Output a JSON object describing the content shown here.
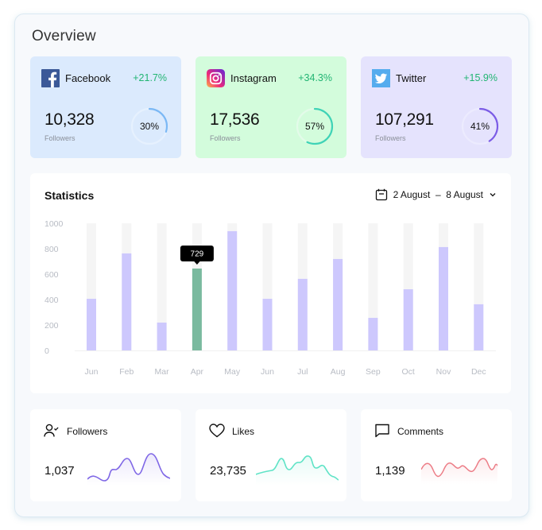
{
  "page": {
    "title": "Overview"
  },
  "social_cards": [
    {
      "network": "Facebook",
      "icon": "facebook-logo-icon",
      "change": "+21.7%",
      "followers": "10,328",
      "followers_label": "Followers",
      "percent_label": "30%",
      "percent": 30,
      "bg": "#dbeafd",
      "ring_color": "#7bb8f5",
      "track_color": "#e6f1fe"
    },
    {
      "network": "Instagram",
      "icon": "instagram-logo-icon",
      "change": "+34.3%",
      "followers": "17,536",
      "followers_label": "Followers",
      "percent_label": "57%",
      "percent": 57,
      "bg": "#d3fcdc",
      "ring_color": "#3fd3b6",
      "track_color": "#e3fbe9"
    },
    {
      "network": "Twitter",
      "icon": "twitter-logo-icon",
      "change": "+15.9%",
      "followers": "107,291",
      "followers_label": "Followers",
      "percent_label": "41%",
      "percent": 41,
      "bg": "#e5e3fd",
      "ring_color": "#7b5ce6",
      "track_color": "#ecebfe"
    }
  ],
  "statistics": {
    "title": "Statistics",
    "date_range": "2 August  –  8 August",
    "tooltip": "729"
  },
  "chart_data": {
    "type": "bar",
    "title": "Statistics",
    "categories": [
      "Jun",
      "Feb",
      "Mar",
      "Apr",
      "May",
      "Jun",
      "Jul",
      "Aug",
      "Sep",
      "Oct",
      "Nov",
      "Dec"
    ],
    "values": [
      406,
      763,
      219,
      644,
      938,
      406,
      563,
      719,
      256,
      481,
      813,
      363
    ],
    "highlighted_index": 3,
    "highlight_label": "729",
    "yticks": [
      0,
      200,
      400,
      600,
      800,
      1000
    ],
    "ylim": [
      0,
      1000
    ],
    "xlabel": "",
    "ylabel": "",
    "grid": false,
    "bar_color": "#cdc8fd",
    "highlight_color": "#7aba9f",
    "track_color": "#f5f5f5"
  },
  "metrics": [
    {
      "label": "Followers",
      "icon": "user-check-icon",
      "value": "1,037",
      "color": "#7f67e6"
    },
    {
      "label": "Likes",
      "icon": "heart-icon",
      "value": "23,735",
      "color": "#5fe3c6"
    },
    {
      "label": "Comments",
      "icon": "comment-icon",
      "value": "1,139",
      "color": "#ec7c86"
    }
  ]
}
